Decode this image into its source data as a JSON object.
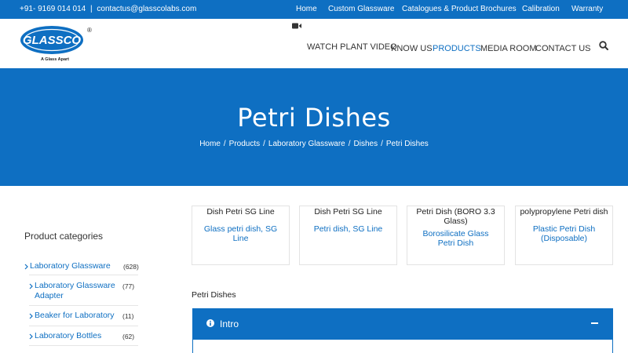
{
  "topbar": {
    "phone": "+91- 9169 014 014",
    "separator": "|",
    "email": "contactus@glasscolabs.com",
    "links": [
      "Home",
      "Custom Glassware",
      "Catalogues & Product Brochures",
      "Calibration",
      "Warranty"
    ]
  },
  "logo": {
    "brand": "GLASSCO",
    "registered": "®",
    "tagline": "A Glass Apart"
  },
  "nav": {
    "video": "WATCH PLANT VIDEO",
    "items": [
      "KNOW US",
      "PRODUCTS",
      "MEDIA ROOM",
      "CONTACT US"
    ],
    "active": "PRODUCTS"
  },
  "hero": {
    "title": "Petri Dishes",
    "breadcrumb": [
      "Home",
      "Products",
      "Laboratory Glassware",
      "Dishes",
      "Petri Dishes"
    ],
    "separator": "/"
  },
  "sidebar": {
    "title": "Product categories",
    "items": [
      {
        "label": "Laboratory Glassware",
        "count": "(628)"
      },
      {
        "label": "Laboratory Glassware Adapter",
        "count": "(77)"
      },
      {
        "label": "Beaker for Laboratory",
        "count": "(11)"
      },
      {
        "label": "Laboratory Bottles",
        "count": "(62)"
      }
    ]
  },
  "products": [
    {
      "title": "Dish Petri SG Line",
      "link": "Glass petri dish, SG Line"
    },
    {
      "title": "Dish Petri SG Line",
      "link": "Petri dish, SG Line"
    },
    {
      "title": "Petri Dish (BORO 3.3 Glass)",
      "link": "Borosilicate Glass Petri Dish"
    },
    {
      "title": "polypropylene Petri dish",
      "link": "Plastic Petri Dish (Disposable)"
    }
  ],
  "section": {
    "label": "Petri Dishes",
    "accordion_label": "Intro"
  },
  "colors": {
    "brand_blue": "#0e6fc2"
  },
  "icons": {
    "video": "video-camera-icon",
    "search": "search-icon",
    "chevron": "chevron-right-icon",
    "info": "info-circle-icon",
    "collapse": "minus-icon"
  }
}
